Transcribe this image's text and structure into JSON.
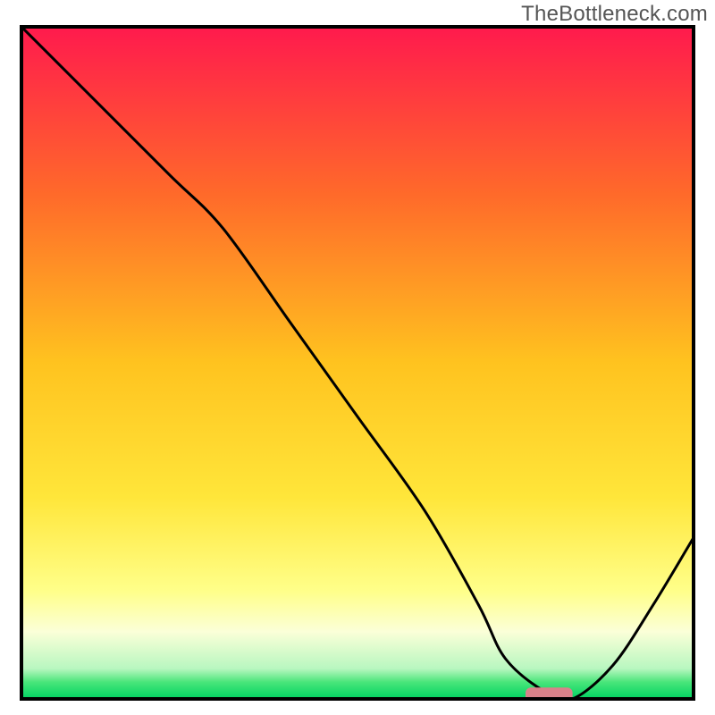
{
  "watermark": "TheBottleneck.com",
  "chart_data": {
    "type": "line",
    "title": "",
    "xlabel": "",
    "ylabel": "",
    "xlim": [
      0,
      100
    ],
    "ylim": [
      0,
      100
    ],
    "grid": false,
    "legend": false,
    "gradient_stops": [
      {
        "offset": 0.0,
        "color": "#ff1a4d"
      },
      {
        "offset": 0.25,
        "color": "#ff6a2a"
      },
      {
        "offset": 0.5,
        "color": "#ffc31f"
      },
      {
        "offset": 0.7,
        "color": "#ffe63a"
      },
      {
        "offset": 0.84,
        "color": "#ffff8a"
      },
      {
        "offset": 0.9,
        "color": "#fbffd8"
      },
      {
        "offset": 0.955,
        "color": "#b8f7c0"
      },
      {
        "offset": 0.975,
        "color": "#49e57a"
      },
      {
        "offset": 1.0,
        "color": "#00d362"
      }
    ],
    "series": [
      {
        "name": "bottleneck-curve",
        "color": "#000000",
        "x": [
          0,
          10,
          22,
          30,
          40,
          50,
          60,
          68,
          72,
          78,
          82,
          88,
          94,
          100
        ],
        "values": [
          100,
          90,
          78,
          70,
          56,
          42,
          28,
          14,
          6,
          1,
          0,
          5,
          14,
          24
        ]
      }
    ],
    "marker": {
      "name": "optimal-range",
      "color": "#d9828a",
      "x_start": 75,
      "x_end": 82,
      "y": 0.6,
      "thickness": 2.2
    },
    "frame": {
      "stroke": "#000000",
      "stroke_width": 4
    }
  }
}
